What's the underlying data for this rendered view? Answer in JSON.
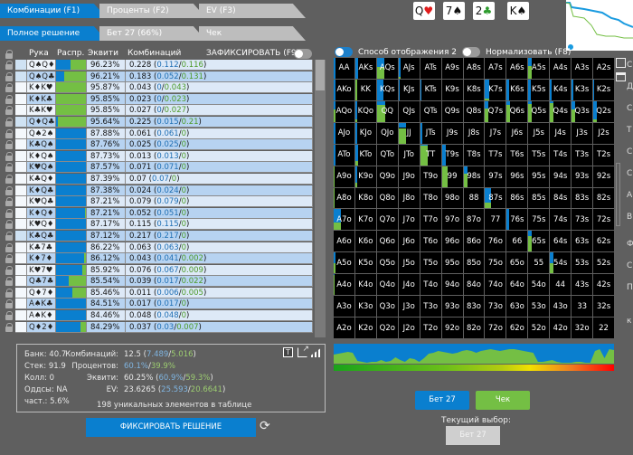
{
  "tabs_top": [
    {
      "label": "Комбинации (F1)",
      "active": true
    },
    {
      "label": "Проценты (F2)",
      "active": false
    },
    {
      "label": "EV (F3)",
      "active": false
    }
  ],
  "tabs_actions": [
    {
      "label": "Полное решение",
      "active": true
    },
    {
      "label": "Бет 27 (66%)",
      "active": false
    },
    {
      "label": "Чек",
      "active": false
    }
  ],
  "table_header": {
    "hand": "Рука",
    "dist": "Распр.",
    "equity": "Эквити",
    "combos": "Комбинаций",
    "lock_toggle": "ЗАФИКСИРОВАТЬ (F9)"
  },
  "colors": {
    "bet": "#0a7fcf",
    "check": "#74bf44",
    "accent": "#0a7fcf"
  },
  "rows": [
    {
      "hand": "Q♠Q♦",
      "equity": "96.23%",
      "total": "0.228",
      "bet": "0.112",
      "check": "0.116",
      "sel": true
    },
    {
      "hand": "Q♠Q♣",
      "equity": "96.21%",
      "total": "0.183",
      "bet": "0.052",
      "check": "0.131",
      "sel": true
    },
    {
      "hand": "K♦K♥",
      "equity": "95.87%",
      "total": "0.043",
      "bet": "0",
      "check": "0.043",
      "sel": false
    },
    {
      "hand": "K♦K♣",
      "equity": "95.85%",
      "total": "0.023",
      "bet": "0",
      "check": "0.023",
      "sel": false
    },
    {
      "hand": "K♣K♥",
      "equity": "95.85%",
      "total": "0.027",
      "bet": "0",
      "check": "0.027",
      "sel": false
    },
    {
      "hand": "Q♦Q♣",
      "equity": "95.64%",
      "total": "0.225",
      "bet": "0.015",
      "check": "0.21",
      "sel": true
    },
    {
      "hand": "Q♠2♠",
      "equity": "87.88%",
      "total": "0.061",
      "bet": "0.061",
      "check": "0",
      "sel": false
    },
    {
      "hand": "K♣Q♠",
      "equity": "87.76%",
      "total": "0.025",
      "bet": "0.025",
      "check": "0",
      "sel": false
    },
    {
      "hand": "K♦Q♠",
      "equity": "87.73%",
      "total": "0.013",
      "bet": "0.013",
      "check": "0",
      "sel": false
    },
    {
      "hand": "K♥Q♠",
      "equity": "87.57%",
      "total": "0.071",
      "bet": "0.071",
      "check": "0",
      "sel": false
    },
    {
      "hand": "K♣Q♦",
      "equity": "87.39%",
      "total": "0.07",
      "bet": "0.07",
      "check": "0",
      "sel": false
    },
    {
      "hand": "K♦Q♣",
      "equity": "87.38%",
      "total": "0.024",
      "bet": "0.024",
      "check": "0",
      "sel": false
    },
    {
      "hand": "K♥Q♣",
      "equity": "87.21%",
      "total": "0.079",
      "bet": "0.079",
      "check": "0",
      "sel": false
    },
    {
      "hand": "K♦Q♦",
      "equity": "87.21%",
      "total": "0.052",
      "bet": "0.051",
      "check": "0",
      "sel": false
    },
    {
      "hand": "K♥Q♦",
      "equity": "87.17%",
      "total": "0.115",
      "bet": "0.115",
      "check": "0",
      "sel": false
    },
    {
      "hand": "K♣Q♣",
      "equity": "87.12%",
      "total": "0.217",
      "bet": "0.217",
      "check": "0",
      "sel": true
    },
    {
      "hand": "K♣7♣",
      "equity": "86.22%",
      "total": "0.063",
      "bet": "0.063",
      "check": "0",
      "sel": false
    },
    {
      "hand": "K♦7♦",
      "equity": "86.12%",
      "total": "0.043",
      "bet": "0.041",
      "check": "0.002",
      "sel": false
    },
    {
      "hand": "K♥7♥",
      "equity": "85.92%",
      "total": "0.076",
      "bet": "0.067",
      "check": "0.009",
      "sel": false
    },
    {
      "hand": "Q♣7♣",
      "equity": "85.54%",
      "total": "0.039",
      "bet": "0.017",
      "check": "0.022",
      "sel": false
    },
    {
      "hand": "Q♦7♦",
      "equity": "85.46%",
      "total": "0.011",
      "bet": "0.006",
      "check": "0.005",
      "sel": false
    },
    {
      "hand": "A♠K♣",
      "equity": "84.51%",
      "total": "0.017",
      "bet": "0.017",
      "check": "0",
      "sel": false
    },
    {
      "hand": "A♠K♦",
      "equity": "84.46%",
      "total": "0.048",
      "bet": "0.048",
      "check": "0",
      "sel": false
    },
    {
      "hand": "Q♦2♦",
      "equity": "84.29%",
      "total": "0.037",
      "bet": "0.03",
      "check": "0.007",
      "sel": false
    }
  ],
  "stats": {
    "pot": "Банк: 40.7",
    "stack": "Стек: 91.9",
    "call": "Колл: 0",
    "odds": "Оддсы: NA",
    "freq": "част.: 5.6%",
    "combos_label": "Комбинаций:",
    "combos_total": "12.5 (",
    "combos_bet": "7.489",
    "combos_check": "5.016",
    "pct_label": "Процентов:",
    "pct_bet": "60.1%",
    "pct_check": "39.9%",
    "eq_label": "Эквити:",
    "eq_total": "60.25% (",
    "eq_bet": "60.9%",
    "eq_check": "59.3%",
    "ev_label": "EV:",
    "ev_total": "23.6265 (",
    "ev_bet": "25.593",
    "ev_check": "20.6641",
    "unique": "198 уникальных элементов в таблице"
  },
  "fix_button": "ФИКСИРОВАТЬ РЕШЕНИЕ",
  "board": [
    {
      "rank": "Q",
      "suit": "♥"
    },
    {
      "rank": "7",
      "suit": "♠"
    },
    {
      "rank": "2",
      "suit": "♣"
    },
    {
      "rank": "K",
      "suit": "♠"
    }
  ],
  "display_mode": "Способ отображения 2",
  "normalize": "Нормализовать (F8)",
  "grid_labels": [
    "AA",
    "AKs",
    "AQs",
    "AJs",
    "ATs",
    "A9s",
    "A8s",
    "A7s",
    "A6s",
    "A5s",
    "A4s",
    "A3s",
    "A2s",
    "AKo",
    "KK",
    "KQs",
    "KJs",
    "KTs",
    "K9s",
    "K8s",
    "K7s",
    "K6s",
    "K5s",
    "K4s",
    "K3s",
    "K2s",
    "AQo",
    "KQo",
    "QQ",
    "QJs",
    "QTs",
    "Q9s",
    "Q8s",
    "Q7s",
    "Q6s",
    "Q5s",
    "Q4s",
    "Q3s",
    "Q2s",
    "AJo",
    "KJo",
    "QJo",
    "JJ",
    "JTs",
    "J9s",
    "J8s",
    "J7s",
    "J6s",
    "J5s",
    "J4s",
    "J3s",
    "J2s",
    "ATo",
    "KTo",
    "QTo",
    "JTo",
    "TT",
    "T9s",
    "T8s",
    "T7s",
    "T6s",
    "T5s",
    "T4s",
    "T3s",
    "T2s",
    "A9o",
    "K9o",
    "Q9o",
    "J9o",
    "T9o",
    "99",
    "98s",
    "97s",
    "96s",
    "95s",
    "94s",
    "93s",
    "92s",
    "A8o",
    "K8o",
    "Q8o",
    "J8o",
    "T8o",
    "98o",
    "88",
    "87s",
    "86s",
    "85s",
    "84s",
    "83s",
    "82s",
    "A7o",
    "K7o",
    "Q7o",
    "J7o",
    "T7o",
    "97o",
    "87o",
    "77",
    "76s",
    "75s",
    "74s",
    "73s",
    "72s",
    "A6o",
    "K6o",
    "Q6o",
    "J6o",
    "T6o",
    "96o",
    "86o",
    "76o",
    "66",
    "65s",
    "64s",
    "63s",
    "62s",
    "A5o",
    "K5o",
    "Q5o",
    "J5o",
    "T5o",
    "95o",
    "85o",
    "75o",
    "65o",
    "55",
    "54s",
    "53s",
    "52s",
    "A4o",
    "K4o",
    "Q4o",
    "J4o",
    "T4o",
    "94o",
    "84o",
    "74o",
    "64o",
    "54o",
    "44",
    "43s",
    "42s",
    "A3o",
    "K3o",
    "Q3o",
    "J3o",
    "T3o",
    "93o",
    "83o",
    "73o",
    "63o",
    "53o",
    "43o",
    "33",
    "32s",
    "A2o",
    "K2o",
    "Q2o",
    "J2o",
    "T2o",
    "92o",
    "82o",
    "72o",
    "62o",
    "52o",
    "42o",
    "32o",
    "22"
  ],
  "grid_mix": {
    "AA": {
      "w": 0.08,
      "bet": 1
    },
    "AKs": {
      "w": 0.12,
      "bet": 1
    },
    "AQs": {
      "w": 0.35,
      "bet": 0.45
    },
    "AJs": {
      "w": 0.08,
      "bet": 0.9
    },
    "A5s": {
      "w": 0.15,
      "bet": 0.4
    },
    "AKo": {
      "w": 0.08,
      "bet": 1
    },
    "KK": {
      "w": 0.08,
      "bet": 0
    },
    "KQs": {
      "w": 0.3,
      "bet": 1
    },
    "KJs": {
      "w": 0.05,
      "bet": 1
    },
    "KTs": {
      "w": 0.05,
      "bet": 1
    },
    "K7s": {
      "w": 0.2,
      "bet": 0.9
    },
    "K6s": {
      "w": 0.1,
      "bet": 1
    },
    "K5s": {
      "w": 0.1,
      "bet": 1
    },
    "K4s": {
      "w": 0.08,
      "bet": 1
    },
    "K3s": {
      "w": 0.05,
      "bet": 1
    },
    "K2s": {
      "w": 0.05,
      "bet": 1
    },
    "AQo": {
      "w": 0.08,
      "bet": 0.4
    },
    "KQo": {
      "w": 0.08,
      "bet": 0.9
    },
    "QQ": {
      "w": 0.4,
      "bet": 0.2
    },
    "Q7s": {
      "w": 0.15,
      "bet": 0.35
    },
    "Q6s": {
      "w": 0.15,
      "bet": 0.2
    },
    "Q5s": {
      "w": 0.15,
      "bet": 0.15
    },
    "Q4s": {
      "w": 0.18,
      "bet": 0.1
    },
    "Q3s": {
      "w": 0.18,
      "bet": 0.4
    },
    "Q2s": {
      "w": 0.18,
      "bet": 0.9
    },
    "AJo": {
      "w": 0.08,
      "bet": 1
    },
    "KJo": {
      "w": 0.08,
      "bet": 1
    },
    "JJ": {
      "w": 0.35,
      "bet": 0.25
    },
    "JTs": {
      "w": 0.08,
      "bet": 1
    },
    "ATo": {
      "w": 0.1,
      "bet": 1
    },
    "KTo": {
      "w": 0.12,
      "bet": 0.8
    },
    "TT": {
      "w": 0.35,
      "bet": 0.05
    },
    "T9s": {
      "w": 0.2,
      "bet": 1
    },
    "A9o": {
      "w": 0.06,
      "bet": 0
    },
    "K9o": {
      "w": 0.1,
      "bet": 0.8
    },
    "99": {
      "w": 0.3,
      "bet": 0
    },
    "98s": {
      "w": 0.2,
      "bet": 0.35
    },
    "A8o": {
      "w": 0.06,
      "bet": 0
    },
    "87s": {
      "w": 0.28,
      "bet": 0.7
    },
    "A7o": {
      "w": 0.35,
      "bet": 0.65
    },
    "76s": {
      "w": 0.12,
      "bet": 1
    },
    "65s": {
      "w": 0.18,
      "bet": 0.25
    },
    "A5o": {
      "w": 0.08,
      "bet": 0.5
    },
    "54s": {
      "w": 0.15,
      "bet": 0.5
    },
    "A4o": {
      "w": 0.06,
      "bet": 0.05
    }
  },
  "dist_chart": [
    0.5,
    0.55,
    0.6,
    0.65,
    0.6,
    0.15,
    0.1,
    0.05,
    0.1,
    0.1,
    0.2,
    0.1,
    0.15,
    0.35,
    0.2,
    0.1,
    0.3,
    0.25,
    0.1,
    0.3,
    0.55,
    0.6,
    0.7,
    0.65,
    0.6,
    0.55,
    0.6,
    0.7,
    0.75,
    0.7,
    0.6,
    0.7,
    0.75,
    0.8,
    0.75,
    0.7,
    0.75,
    0.8,
    0.8,
    0.75,
    0.7,
    0.65,
    0.6,
    0.1,
    0.1,
    0.15,
    0.2,
    0.1,
    0.05,
    0.05,
    0.05,
    0.1,
    0.1,
    0.05,
    0.05,
    0.7,
    0.8,
    0.3,
    0.8,
    0.75
  ],
  "actions": {
    "bet": "Бет 27",
    "check": "Чек"
  },
  "current_choice_label": "Текущий выбор:",
  "current_choice": "Бет 27",
  "side_letters": [
    "С",
    "Д",
    "С",
    "Т",
    "С",
    "С",
    "А",
    "В",
    "Ф",
    "С",
    "П",
    "к"
  ]
}
